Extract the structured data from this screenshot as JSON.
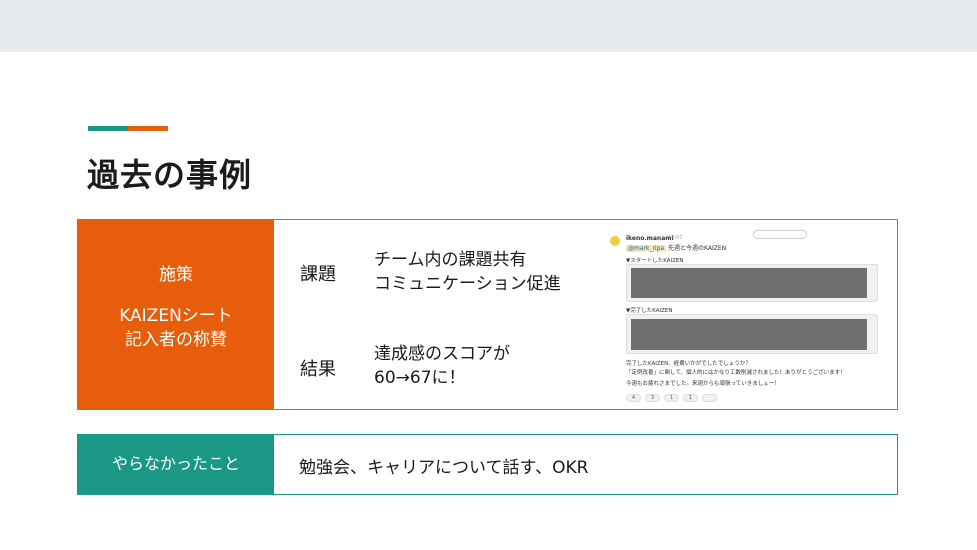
{
  "slide": {
    "title": "過去の事例",
    "case": {
      "side_label_1": "施策",
      "side_label_2_line1": "KAIZENシート",
      "side_label_2_line2": "記入者の称賛",
      "issue_label": "課題",
      "issue_line1": "チーム内の課題共有",
      "issue_line2": "コミュニケーション促進",
      "result_label": "結果",
      "result_line1": "達成感のスコアが",
      "result_line2": "60→67に！"
    },
    "slack_post": {
      "username": "ikeno.manami",
      "time": "19:07",
      "mention_tag": "@mark_ripa",
      "mention_text": "先週と今週のKAIZEN",
      "started_header": "▼スタートしたKAIZEN",
      "finished_header": "▼完了したKAIZEN",
      "msg_line1": "完了したKAIZEN、経費いかがでしたでしょうか？",
      "msg_line2": "「定例改善」に関して、個人的にはかなり工数削減されました！ありがとうございます！",
      "msg_line3": "今週もお疲れさまでした。来週からも頑張っていきましょー！",
      "reactions": [
        "4",
        "3",
        "1",
        "1",
        ""
      ]
    },
    "not_done": {
      "label": "やらなかったこと",
      "text": "勉強会、キャリアについて話す、OKR"
    }
  }
}
